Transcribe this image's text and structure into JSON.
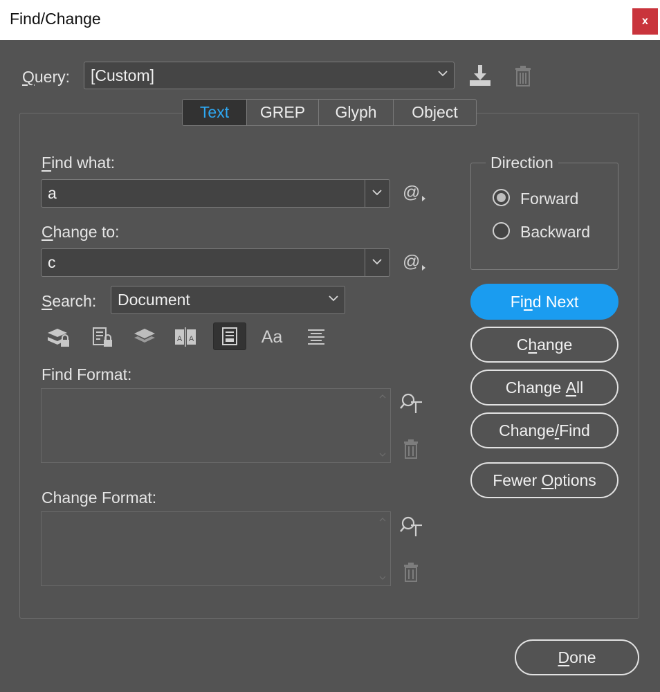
{
  "window": {
    "title": "Find/Change",
    "close_label": "x"
  },
  "query": {
    "label_prefix": "Q",
    "label_rest": "uery:",
    "value": "[Custom]"
  },
  "tabs": [
    "Text",
    "GREP",
    "Glyph",
    "Object"
  ],
  "active_tab": "Text",
  "find_what": {
    "label_prefix": "F",
    "label_rest": "ind what:",
    "value": "a"
  },
  "change_to": {
    "label_prefix": "C",
    "label_rest": "hange to:",
    "value": "c"
  },
  "search": {
    "label_prefix": "S",
    "label_rest": "earch:",
    "value": "Document"
  },
  "option_icons": [
    "include-locked-layers-icon",
    "include-locked-stories-icon",
    "include-hidden-layers-icon",
    "include-master-pages-icon",
    "include-footnotes-icon",
    "case-sensitive-icon",
    "whole-word-icon"
  ],
  "option_icons_text": {
    "case_sensitive": "Aa"
  },
  "find_format": {
    "label": "Find Format:"
  },
  "change_format": {
    "label": "Change Format:"
  },
  "direction": {
    "title": "Direction",
    "options": [
      "Forward",
      "Backward"
    ],
    "selected": "Forward"
  },
  "buttons": {
    "find_next": {
      "pre": "Fi",
      "ul": "n",
      "post": "d Next"
    },
    "change": {
      "pre": "C",
      "ul": "h",
      "post": "ange"
    },
    "change_all": {
      "pre": "Change ",
      "ul": "A",
      "post": "ll"
    },
    "change_find": {
      "pre": "Change",
      "ul": "/",
      "post": "Find"
    },
    "fewer_options": {
      "pre": "Fewer ",
      "ul": "O",
      "post": "ptions"
    },
    "done": {
      "pre": "",
      "ul": "D",
      "post": "one"
    }
  },
  "colors": {
    "background": "#535353",
    "accent": "#1a9cf0",
    "active_tab_text": "#2ea8f3",
    "close_red": "#c9343c"
  }
}
